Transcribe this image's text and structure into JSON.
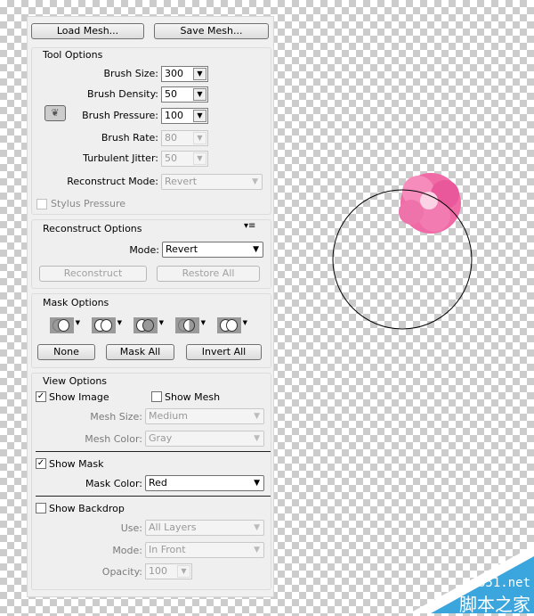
{
  "mesh": {
    "load": "Load Mesh...",
    "save": "Save Mesh..."
  },
  "tool_options": {
    "title": "Tool Options",
    "brush_size": {
      "label": "Brush Size:",
      "value": "300"
    },
    "brush_density": {
      "label": "Brush Density:",
      "value": "50"
    },
    "brush_pressure": {
      "label": "Brush Pressure:",
      "value": "100"
    },
    "brush_rate": {
      "label": "Brush Rate:",
      "value": "80"
    },
    "turbulent_jitter": {
      "label": "Turbulent Jitter:",
      "value": "50"
    },
    "reconstruct_mode": {
      "label": "Reconstruct Mode:",
      "value": "Revert"
    },
    "stylus_pressure": "Stylus Pressure"
  },
  "reconstruct_options": {
    "title": "Reconstruct Options",
    "mode_label": "Mode:",
    "mode_value": "Revert",
    "reconstruct": "Reconstruct",
    "restore_all": "Restore All"
  },
  "mask_options": {
    "title": "Mask Options",
    "none": "None",
    "mask_all": "Mask All",
    "invert_all": "Invert All"
  },
  "view_options": {
    "title": "View Options",
    "show_image": "Show Image",
    "show_image_checked": true,
    "show_mesh": "Show Mesh",
    "show_mesh_checked": false,
    "mesh_size_label": "Mesh Size:",
    "mesh_size": "Medium",
    "mesh_color_label": "Mesh Color:",
    "mesh_color": "Gray",
    "show_mask": "Show Mask",
    "show_mask_checked": true,
    "mask_color_label": "Mask Color:",
    "mask_color": "Red",
    "show_backdrop": "Show Backdrop",
    "show_backdrop_checked": false,
    "use_label": "Use:",
    "use": "All Layers",
    "mode_label": "Mode:",
    "mode": "In Front",
    "opacity_label": "Opacity:",
    "opacity": "100"
  },
  "watermark": {
    "url": "jb51.net",
    "name": "脚本之家",
    "color": "#3aa6dd"
  }
}
